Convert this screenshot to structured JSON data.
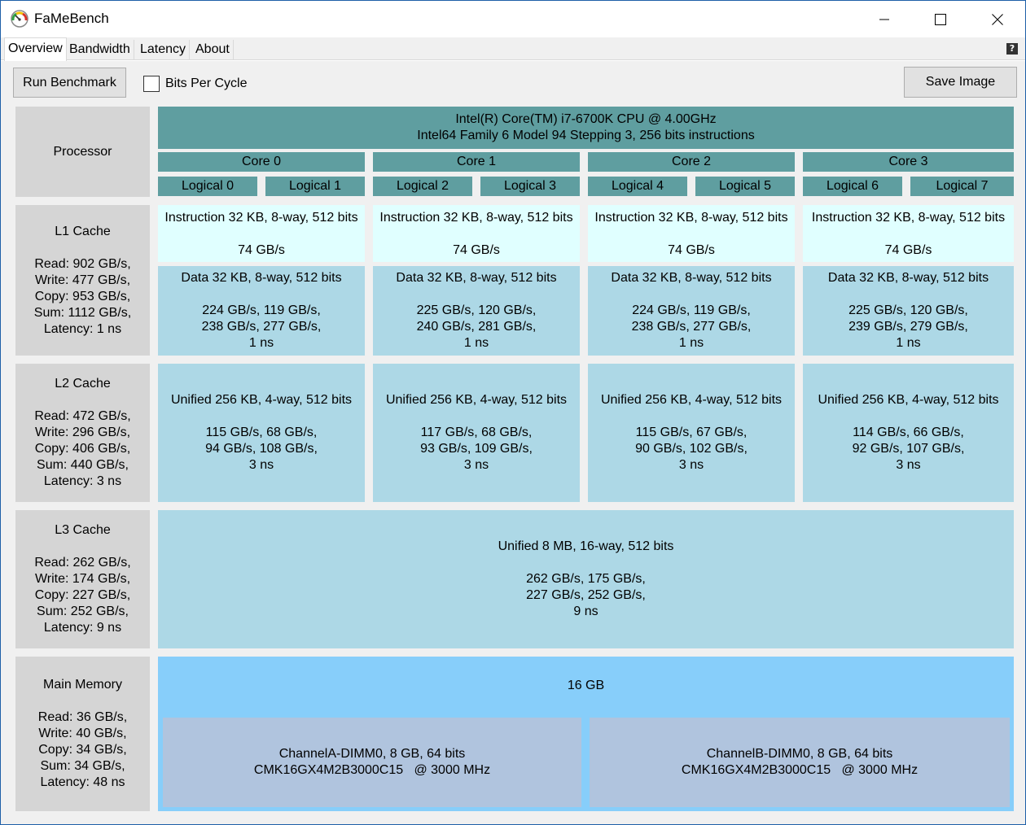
{
  "window": {
    "title": "FaMeBench"
  },
  "tabs": [
    {
      "label": "Overview"
    },
    {
      "label": "Bandwidth"
    },
    {
      "label": "Latency"
    },
    {
      "label": "About"
    }
  ],
  "help_label": "?",
  "toolbar": {
    "run_label": "Run Benchmark",
    "bits_per_cycle_label": "Bits Per Cycle",
    "bits_per_cycle_checked": false,
    "save_label": "Save Image"
  },
  "colors": {
    "processor": "#5f9ea0",
    "l1_instruction": "#e0ffff",
    "cache": "#add8e6",
    "memory": "#87cefa",
    "dimm": "#b0c4de",
    "label_bg": "#d5d5d5"
  },
  "processor": {
    "label": "Processor",
    "name": "Intel(R) Core(TM) i7-6700K CPU @ 4.00GHz",
    "family": "Intel64 Family 6 Model 94 Stepping 3, 256 bits instructions",
    "cores": [
      {
        "label": "Core 0",
        "logical": [
          "Logical 0",
          "Logical 1"
        ]
      },
      {
        "label": "Core 1",
        "logical": [
          "Logical 2",
          "Logical 3"
        ]
      },
      {
        "label": "Core 2",
        "logical": [
          "Logical 4",
          "Logical 5"
        ]
      },
      {
        "label": "Core 3",
        "logical": [
          "Logical 6",
          "Logical 7"
        ]
      }
    ]
  },
  "l1": {
    "label": "L1 Cache",
    "stats": [
      "Read: 902 GB/s,",
      "Write: 477 GB/s,",
      "Copy: 953 GB/s,",
      "Sum: 1112 GB/s,",
      "Latency: 1 ns"
    ],
    "instruction": [
      {
        "desc": "Instruction 32 KB, 8-way, 512 bits",
        "speed": "74 GB/s"
      },
      {
        "desc": "Instruction 32 KB, 8-way, 512 bits",
        "speed": "74 GB/s"
      },
      {
        "desc": "Instruction 32 KB, 8-way, 512 bits",
        "speed": "74 GB/s"
      },
      {
        "desc": "Instruction 32 KB, 8-way, 512 bits",
        "speed": "74 GB/s"
      }
    ],
    "data": [
      {
        "desc": "Data 32 KB, 8-way, 512 bits",
        "line1": "224 GB/s, 119 GB/s,",
        "line2": "238 GB/s, 277 GB/s,",
        "latency": "1 ns"
      },
      {
        "desc": "Data 32 KB, 8-way, 512 bits",
        "line1": "225 GB/s, 120 GB/s,",
        "line2": "240 GB/s, 281 GB/s,",
        "latency": "1 ns"
      },
      {
        "desc": "Data 32 KB, 8-way, 512 bits",
        "line1": "224 GB/s, 119 GB/s,",
        "line2": "238 GB/s, 277 GB/s,",
        "latency": "1 ns"
      },
      {
        "desc": "Data 32 KB, 8-way, 512 bits",
        "line1": "225 GB/s, 120 GB/s,",
        "line2": "239 GB/s, 279 GB/s,",
        "latency": "1 ns"
      }
    ]
  },
  "l2": {
    "label": "L2 Cache",
    "stats": [
      "Read: 472 GB/s,",
      "Write: 296 GB/s,",
      "Copy: 406 GB/s,",
      "Sum: 440 GB/s,",
      "Latency: 3 ns"
    ],
    "units": [
      {
        "desc": "Unified 256 KB, 4-way, 512 bits",
        "line1": "115 GB/s, 68 GB/s,",
        "line2": "94 GB/s, 108 GB/s,",
        "latency": "3 ns"
      },
      {
        "desc": "Unified 256 KB, 4-way, 512 bits",
        "line1": "117 GB/s, 68 GB/s,",
        "line2": "93 GB/s, 109 GB/s,",
        "latency": "3 ns"
      },
      {
        "desc": "Unified 256 KB, 4-way, 512 bits",
        "line1": "115 GB/s, 67 GB/s,",
        "line2": "90 GB/s, 102 GB/s,",
        "latency": "3 ns"
      },
      {
        "desc": "Unified 256 KB, 4-way, 512 bits",
        "line1": "114 GB/s, 66 GB/s,",
        "line2": "92 GB/s, 107 GB/s,",
        "latency": "3 ns"
      }
    ]
  },
  "l3": {
    "label": "L3 Cache",
    "stats": [
      "Read: 262 GB/s,",
      "Write: 174 GB/s,",
      "Copy: 227 GB/s,",
      "Sum: 252 GB/s,",
      "Latency: 9 ns"
    ],
    "desc": "Unified 8 MB, 16-way, 512 bits",
    "line1": "262 GB/s, 175 GB/s,",
    "line2": "227 GB/s, 252 GB/s,",
    "latency": "9 ns"
  },
  "memory": {
    "label": "Main Memory",
    "stats": [
      "Read: 36 GB/s,",
      "Write: 40 GB/s,",
      "Copy: 34 GB/s,",
      "Sum: 34 GB/s,",
      "Latency: 48 ns"
    ],
    "total": "16 GB",
    "dimms": [
      {
        "line1": "ChannelA-DIMM0, 8 GB, 64 bits",
        "line2": "CMK16GX4M2B3000C15   @ 3000 MHz"
      },
      {
        "line1": "ChannelB-DIMM0, 8 GB, 64 bits",
        "line2": "CMK16GX4M2B3000C15   @ 3000 MHz"
      }
    ]
  }
}
